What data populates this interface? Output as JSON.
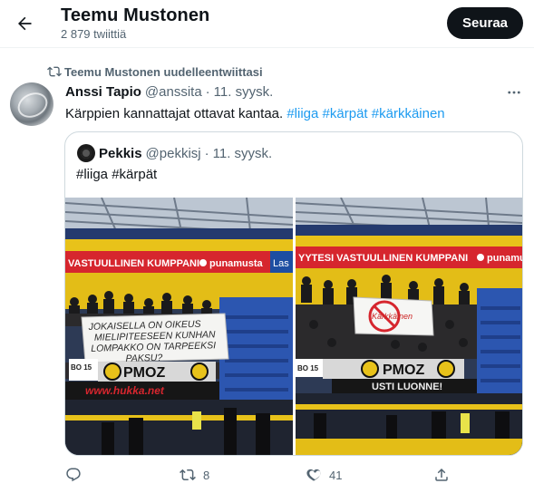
{
  "header": {
    "title": "Teemu Mustonen",
    "tweet_count": "2 879 twiittiä",
    "follow_label": "Seuraa"
  },
  "tweet": {
    "retweet_context": "Teemu Mustonen uudelleentwiittasi",
    "author_name": "Anssi Tapio",
    "author_handle": "@anssita",
    "separator": "·",
    "date": "11. syysk.",
    "text_plain": "Kärppien kannattajat ottavat kantaa. ",
    "hashtags": [
      "#liiga",
      "#kärpät",
      "#kärkkäinen"
    ],
    "quoted": {
      "author_name": "Pekkis",
      "author_handle": "@pekkisj",
      "separator": "·",
      "date": "11. syysk.",
      "text": "#liiga #kärpät",
      "photo1": {
        "board_top": "VASTUULLINEN KUMPPANI",
        "board_brand": "punamusta",
        "board_extra": "Las",
        "banner_lines": [
          "JOKAISELLA ON OIKEUS",
          "MIELIPITEESEEN KUNHAN",
          "LOMPAKKO ON TARPEEKSI",
          "PAKSU?"
        ],
        "flag_text": "PMOZ",
        "rail_text": "www.hukka.net",
        "number_text": "BO 15"
      },
      "photo2": {
        "board_top": "YYTESI VASTUULLINEN KUMPPANI",
        "board_brand": "punamusta",
        "banner_text": "Kärkkäinen",
        "flag_text": "PMOZ",
        "rail_text": "USTI LUONNE!",
        "number_text": "BO 15"
      }
    },
    "retweets": "8",
    "likes": "41"
  },
  "colors": {
    "accent": "#1d9bf0",
    "text": "#0f1419",
    "muted": "#536471",
    "border": "#cfd9de",
    "board_red": "#d6262e",
    "arena_yellow": "#e8c21a"
  }
}
